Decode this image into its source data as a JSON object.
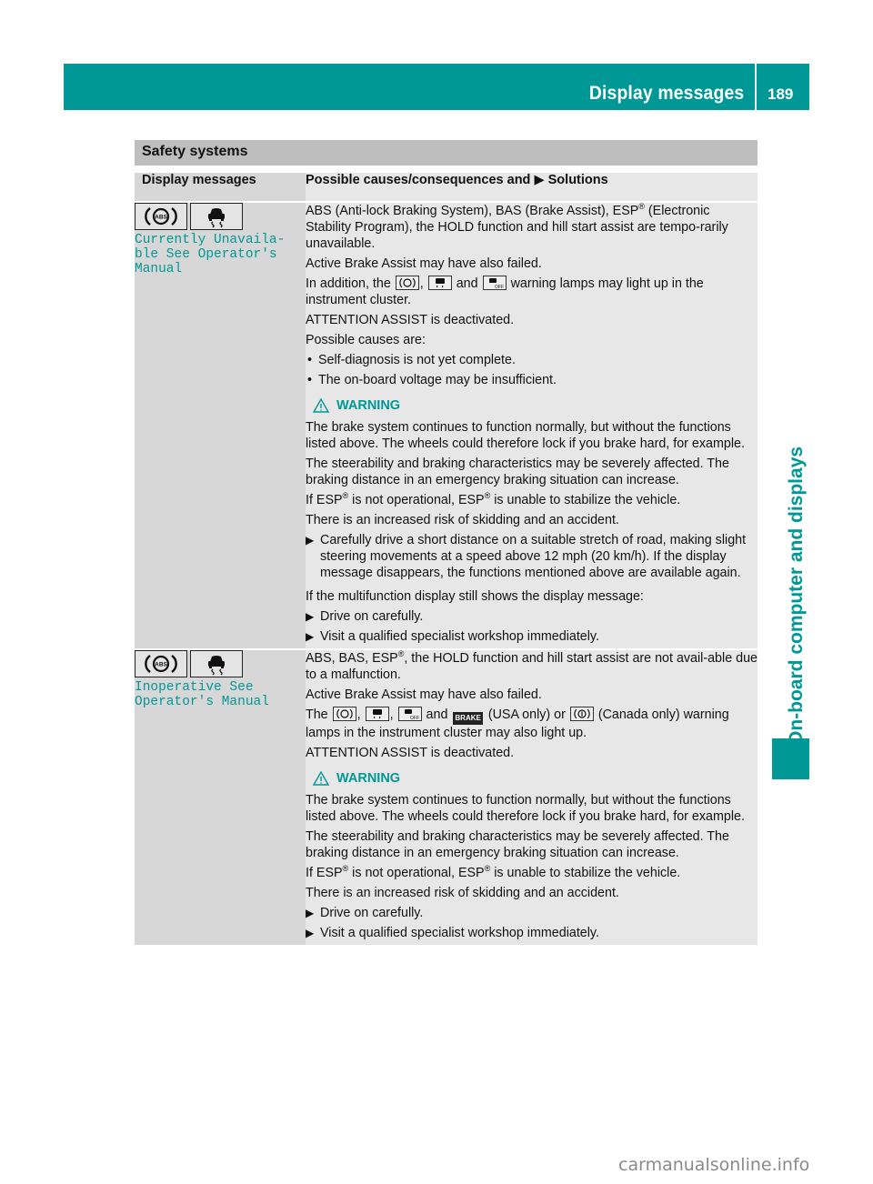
{
  "header": {
    "title": "Display messages",
    "page_number": "189",
    "side_tab": "On-board computer and displays",
    "accent_color": "#009896"
  },
  "section": {
    "title": "Safety systems"
  },
  "table": {
    "col_left_header": "Display messages",
    "col_right_header_before": "Possible causes/consequences and",
    "col_right_header_arrow": "▶",
    "col_right_header_after": "Solutions",
    "rows": [
      {
        "icons": [
          "abs-warning-icon",
          "esp-skid-icon"
        ],
        "message": "Currently Unavaila-\nble See Operator's\nManual",
        "para1": "ABS (Anti-lock Braking System), BAS (Brake Assist), ESP",
        "para1_reg": "®",
        "para1_rest": " (Electronic Stability Program), the HOLD function and hill start assist are tempo-rarily unavailable.",
        "para2": "Active Brake Assist may have also failed.",
        "para3_a": "In addition, the",
        "para3_b": ",",
        "para3_c": "and",
        "para3_d": "warning lamps may light up in the instrument cluster.",
        "para4": "ATTENTION ASSIST is deactivated.",
        "para5": "Possible causes are:",
        "bullets": [
          "Self-diagnosis is not yet complete.",
          "The on-board voltage may be insufficient."
        ],
        "warning_label": "WARNING",
        "warn1": "The brake system continues to function normally, but without the functions listed above. The wheels could therefore lock if you brake hard, for example.",
        "warn2": "The steerability and braking characteristics may be severely affected. The braking distance in an emergency braking situation can increase.",
        "warn3_a": "If ESP",
        "warn3_b": " is not operational, ESP",
        "warn3_c": " is unable to stabilize the vehicle.",
        "warn4": "There is an increased risk of skidding and an accident.",
        "step1": "Carefully drive a short distance on a suitable stretch of road, making slight steering movements at a speed above 12 mph (20 km/h). If the display message disappears, the functions mentioned above are available again.",
        "para6": "If the multifunction display still shows the display message:",
        "steps": [
          "Drive on carefully.",
          "Visit a qualified specialist workshop immediately."
        ]
      },
      {
        "icons": [
          "abs-warning-icon",
          "esp-skid-icon"
        ],
        "message": "Inoperative See\nOperator's Manual",
        "para1_a": "ABS, BAS, ESP",
        "para1_reg": "®",
        "para1_b": ", the HOLD function and hill start assist are not avail-able due to a malfunction.",
        "para2": "Active Brake Assist may have also failed.",
        "para3_a": "The",
        "para3_sep": ",",
        "para3_and": "and",
        "brake_label": "BRAKE",
        "para3_usa": "(USA only) or",
        "para3_canada": "(Canada only) warning lamps in the instrument cluster may also light up.",
        "para4": "ATTENTION ASSIST is deactivated.",
        "warning_label": "WARNING",
        "warn1": "The brake system continues to function normally, but without the functions listed above. The wheels could therefore lock if you brake hard, for example.",
        "warn2": "The steerability and braking characteristics may be severely affected. The braking distance in an emergency braking situation can increase.",
        "warn3_a": "If ESP",
        "warn3_b": " is not operational, ESP",
        "warn3_c": " is unable to stabilize the vehicle.",
        "warn4": "There is an increased risk of skidding and an accident.",
        "steps": [
          "Drive on carefully.",
          "Visit a qualified specialist workshop immediately."
        ]
      }
    ]
  },
  "footer": {
    "watermark": "carmanualsonline.info"
  }
}
